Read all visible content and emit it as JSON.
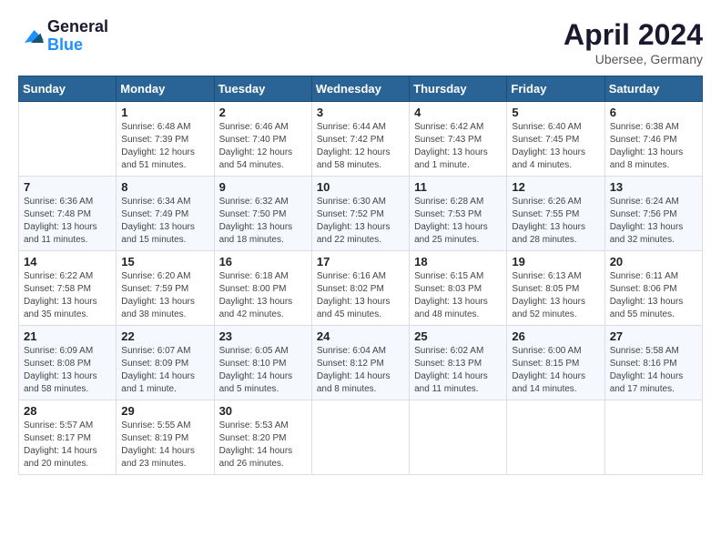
{
  "logo": {
    "general": "General",
    "blue": "Blue"
  },
  "header": {
    "month": "April 2024",
    "location": "Ubersee, Germany"
  },
  "weekdays": [
    "Sunday",
    "Monday",
    "Tuesday",
    "Wednesday",
    "Thursday",
    "Friday",
    "Saturday"
  ],
  "weeks": [
    [
      {
        "day": "",
        "sunrise": "",
        "sunset": "",
        "daylight": ""
      },
      {
        "day": "1",
        "sunrise": "Sunrise: 6:48 AM",
        "sunset": "Sunset: 7:39 PM",
        "daylight": "Daylight: 12 hours and 51 minutes."
      },
      {
        "day": "2",
        "sunrise": "Sunrise: 6:46 AM",
        "sunset": "Sunset: 7:40 PM",
        "daylight": "Daylight: 12 hours and 54 minutes."
      },
      {
        "day": "3",
        "sunrise": "Sunrise: 6:44 AM",
        "sunset": "Sunset: 7:42 PM",
        "daylight": "Daylight: 12 hours and 58 minutes."
      },
      {
        "day": "4",
        "sunrise": "Sunrise: 6:42 AM",
        "sunset": "Sunset: 7:43 PM",
        "daylight": "Daylight: 13 hours and 1 minute."
      },
      {
        "day": "5",
        "sunrise": "Sunrise: 6:40 AM",
        "sunset": "Sunset: 7:45 PM",
        "daylight": "Daylight: 13 hours and 4 minutes."
      },
      {
        "day": "6",
        "sunrise": "Sunrise: 6:38 AM",
        "sunset": "Sunset: 7:46 PM",
        "daylight": "Daylight: 13 hours and 8 minutes."
      }
    ],
    [
      {
        "day": "7",
        "sunrise": "Sunrise: 6:36 AM",
        "sunset": "Sunset: 7:48 PM",
        "daylight": "Daylight: 13 hours and 11 minutes."
      },
      {
        "day": "8",
        "sunrise": "Sunrise: 6:34 AM",
        "sunset": "Sunset: 7:49 PM",
        "daylight": "Daylight: 13 hours and 15 minutes."
      },
      {
        "day": "9",
        "sunrise": "Sunrise: 6:32 AM",
        "sunset": "Sunset: 7:50 PM",
        "daylight": "Daylight: 13 hours and 18 minutes."
      },
      {
        "day": "10",
        "sunrise": "Sunrise: 6:30 AM",
        "sunset": "Sunset: 7:52 PM",
        "daylight": "Daylight: 13 hours and 22 minutes."
      },
      {
        "day": "11",
        "sunrise": "Sunrise: 6:28 AM",
        "sunset": "Sunset: 7:53 PM",
        "daylight": "Daylight: 13 hours and 25 minutes."
      },
      {
        "day": "12",
        "sunrise": "Sunrise: 6:26 AM",
        "sunset": "Sunset: 7:55 PM",
        "daylight": "Daylight: 13 hours and 28 minutes."
      },
      {
        "day": "13",
        "sunrise": "Sunrise: 6:24 AM",
        "sunset": "Sunset: 7:56 PM",
        "daylight": "Daylight: 13 hours and 32 minutes."
      }
    ],
    [
      {
        "day": "14",
        "sunrise": "Sunrise: 6:22 AM",
        "sunset": "Sunset: 7:58 PM",
        "daylight": "Daylight: 13 hours and 35 minutes."
      },
      {
        "day": "15",
        "sunrise": "Sunrise: 6:20 AM",
        "sunset": "Sunset: 7:59 PM",
        "daylight": "Daylight: 13 hours and 38 minutes."
      },
      {
        "day": "16",
        "sunrise": "Sunrise: 6:18 AM",
        "sunset": "Sunset: 8:00 PM",
        "daylight": "Daylight: 13 hours and 42 minutes."
      },
      {
        "day": "17",
        "sunrise": "Sunrise: 6:16 AM",
        "sunset": "Sunset: 8:02 PM",
        "daylight": "Daylight: 13 hours and 45 minutes."
      },
      {
        "day": "18",
        "sunrise": "Sunrise: 6:15 AM",
        "sunset": "Sunset: 8:03 PM",
        "daylight": "Daylight: 13 hours and 48 minutes."
      },
      {
        "day": "19",
        "sunrise": "Sunrise: 6:13 AM",
        "sunset": "Sunset: 8:05 PM",
        "daylight": "Daylight: 13 hours and 52 minutes."
      },
      {
        "day": "20",
        "sunrise": "Sunrise: 6:11 AM",
        "sunset": "Sunset: 8:06 PM",
        "daylight": "Daylight: 13 hours and 55 minutes."
      }
    ],
    [
      {
        "day": "21",
        "sunrise": "Sunrise: 6:09 AM",
        "sunset": "Sunset: 8:08 PM",
        "daylight": "Daylight: 13 hours and 58 minutes."
      },
      {
        "day": "22",
        "sunrise": "Sunrise: 6:07 AM",
        "sunset": "Sunset: 8:09 PM",
        "daylight": "Daylight: 14 hours and 1 minute."
      },
      {
        "day": "23",
        "sunrise": "Sunrise: 6:05 AM",
        "sunset": "Sunset: 8:10 PM",
        "daylight": "Daylight: 14 hours and 5 minutes."
      },
      {
        "day": "24",
        "sunrise": "Sunrise: 6:04 AM",
        "sunset": "Sunset: 8:12 PM",
        "daylight": "Daylight: 14 hours and 8 minutes."
      },
      {
        "day": "25",
        "sunrise": "Sunrise: 6:02 AM",
        "sunset": "Sunset: 8:13 PM",
        "daylight": "Daylight: 14 hours and 11 minutes."
      },
      {
        "day": "26",
        "sunrise": "Sunrise: 6:00 AM",
        "sunset": "Sunset: 8:15 PM",
        "daylight": "Daylight: 14 hours and 14 minutes."
      },
      {
        "day": "27",
        "sunrise": "Sunrise: 5:58 AM",
        "sunset": "Sunset: 8:16 PM",
        "daylight": "Daylight: 14 hours and 17 minutes."
      }
    ],
    [
      {
        "day": "28",
        "sunrise": "Sunrise: 5:57 AM",
        "sunset": "Sunset: 8:17 PM",
        "daylight": "Daylight: 14 hours and 20 minutes."
      },
      {
        "day": "29",
        "sunrise": "Sunrise: 5:55 AM",
        "sunset": "Sunset: 8:19 PM",
        "daylight": "Daylight: 14 hours and 23 minutes."
      },
      {
        "day": "30",
        "sunrise": "Sunrise: 5:53 AM",
        "sunset": "Sunset: 8:20 PM",
        "daylight": "Daylight: 14 hours and 26 minutes."
      },
      {
        "day": "",
        "sunrise": "",
        "sunset": "",
        "daylight": ""
      },
      {
        "day": "",
        "sunrise": "",
        "sunset": "",
        "daylight": ""
      },
      {
        "day": "",
        "sunrise": "",
        "sunset": "",
        "daylight": ""
      },
      {
        "day": "",
        "sunrise": "",
        "sunset": "",
        "daylight": ""
      }
    ]
  ]
}
